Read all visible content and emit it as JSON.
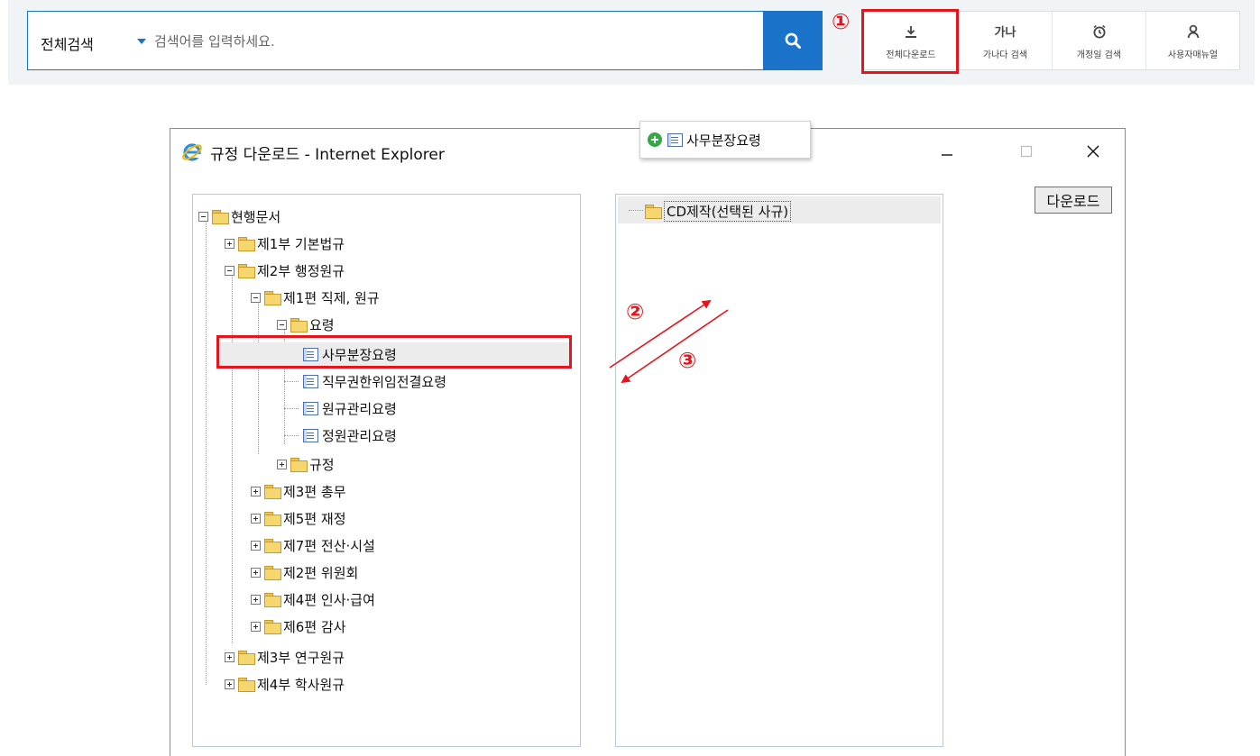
{
  "search": {
    "scope_label": "전체검색",
    "placeholder": "검색어를 입력하세요."
  },
  "toolbar": {
    "items": [
      {
        "label": "전체다운로드",
        "icon": "download-icon"
      },
      {
        "label": "가나다 검색",
        "icon": "hangul-index-icon",
        "glyph": "가나"
      },
      {
        "label": "개정일 검색",
        "icon": "clock-icon"
      },
      {
        "label": "사용자매뉴얼",
        "icon": "user-icon"
      }
    ]
  },
  "annotations": {
    "step1": "①",
    "step2": "②",
    "step3": "③",
    "highlight_color": "#e8141c"
  },
  "window": {
    "title": "규정 다운로드 - Internet Explorer",
    "download_button": "다운로드"
  },
  "tree": {
    "root": "현행문서",
    "part1": "제1부 기본법규",
    "part2": "제2부 행정원규",
    "chapter1": "제1편 직제, 원규",
    "folder_guidelines": "요령",
    "doc1": "사무분장요령",
    "doc2": "직무권한위임전결요령",
    "doc3": "원규관리요령",
    "doc4": "정원관리요령",
    "folder_rules": "규정",
    "chapter3": "제3편 총무",
    "chapter5": "제5편 재정",
    "chapter7": "제7편 전산·시설",
    "chapter2": "제2편 위원회",
    "chapter4": "제4편 인사·급여",
    "chapter6": "제6편 감사",
    "part3": "제3부 연구원규",
    "part4": "제4부 학사원규"
  },
  "selection": {
    "folder": "CD제작(선택된 사규)",
    "added_item": "사무분장요령"
  },
  "colors": {
    "accent": "#1a72c9",
    "topbar_bg": "#f0f4f7",
    "pane_border": "#b9c9db"
  }
}
